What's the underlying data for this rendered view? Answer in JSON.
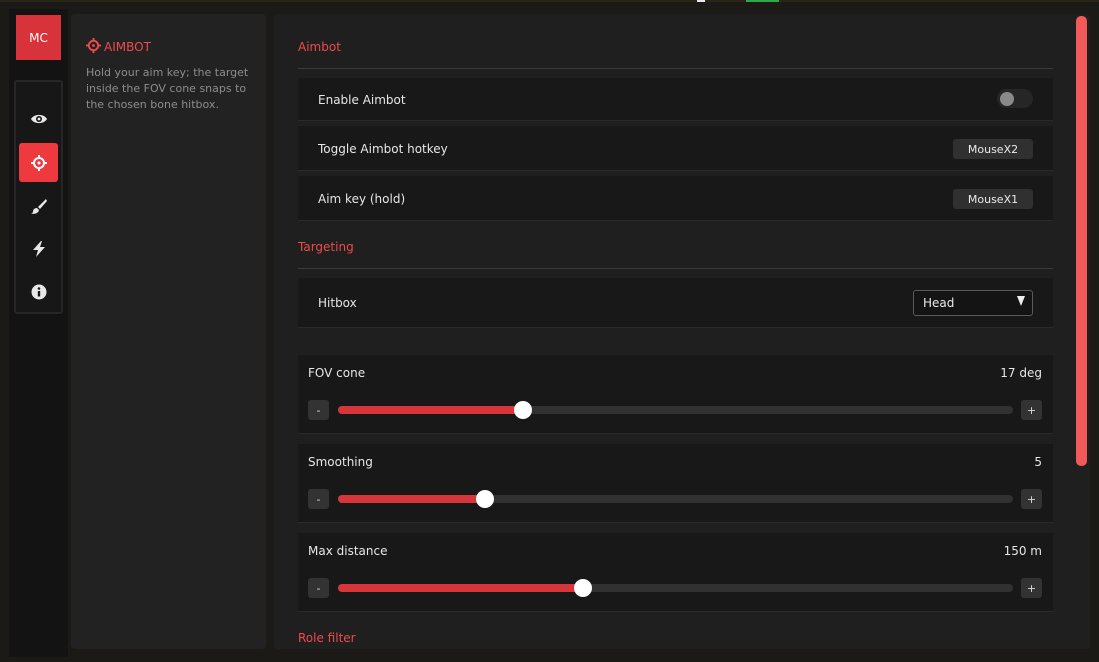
{
  "app": {
    "logo_text": "MC"
  },
  "rail": {
    "items": [
      {
        "icon": "eye-icon",
        "active": false
      },
      {
        "icon": "crosshair-icon",
        "active": true
      },
      {
        "icon": "brush-icon",
        "active": false
      },
      {
        "icon": "lightning-icon",
        "active": false
      },
      {
        "icon": "info-icon",
        "active": false
      }
    ]
  },
  "description": {
    "title": "AIMBOT",
    "text": "Hold your aim key; the target inside the FOV cone snaps to the chosen bone hitbox."
  },
  "sections": {
    "aimbot": "Aimbot",
    "targeting": "Targeting",
    "role_filter": "Role filter"
  },
  "settings": {
    "enable_aimbot": {
      "label": "Enable Aimbot",
      "value": false
    },
    "toggle_hotkey": {
      "label": "Toggle Aimbot hotkey",
      "value": "MouseX2"
    },
    "aim_key": {
      "label": "Aim key (hold)",
      "value": "MouseX1"
    },
    "hitbox": {
      "label": "Hitbox",
      "value": "Head"
    }
  },
  "sliders": {
    "fov": {
      "label": "FOV cone",
      "value_text": "17 deg",
      "fraction": 0.274
    },
    "smoothing": {
      "label": "Smoothing",
      "value_text": "5",
      "fraction": 0.218
    },
    "max_distance": {
      "label": "Max distance",
      "value_text": "150 m",
      "fraction": 0.363
    }
  },
  "stepper": {
    "minus": "-",
    "plus": "+"
  },
  "colors": {
    "accent": "#ee3a3f",
    "slider_fill": "#d8353b",
    "section_title": "#ef4a4a"
  }
}
